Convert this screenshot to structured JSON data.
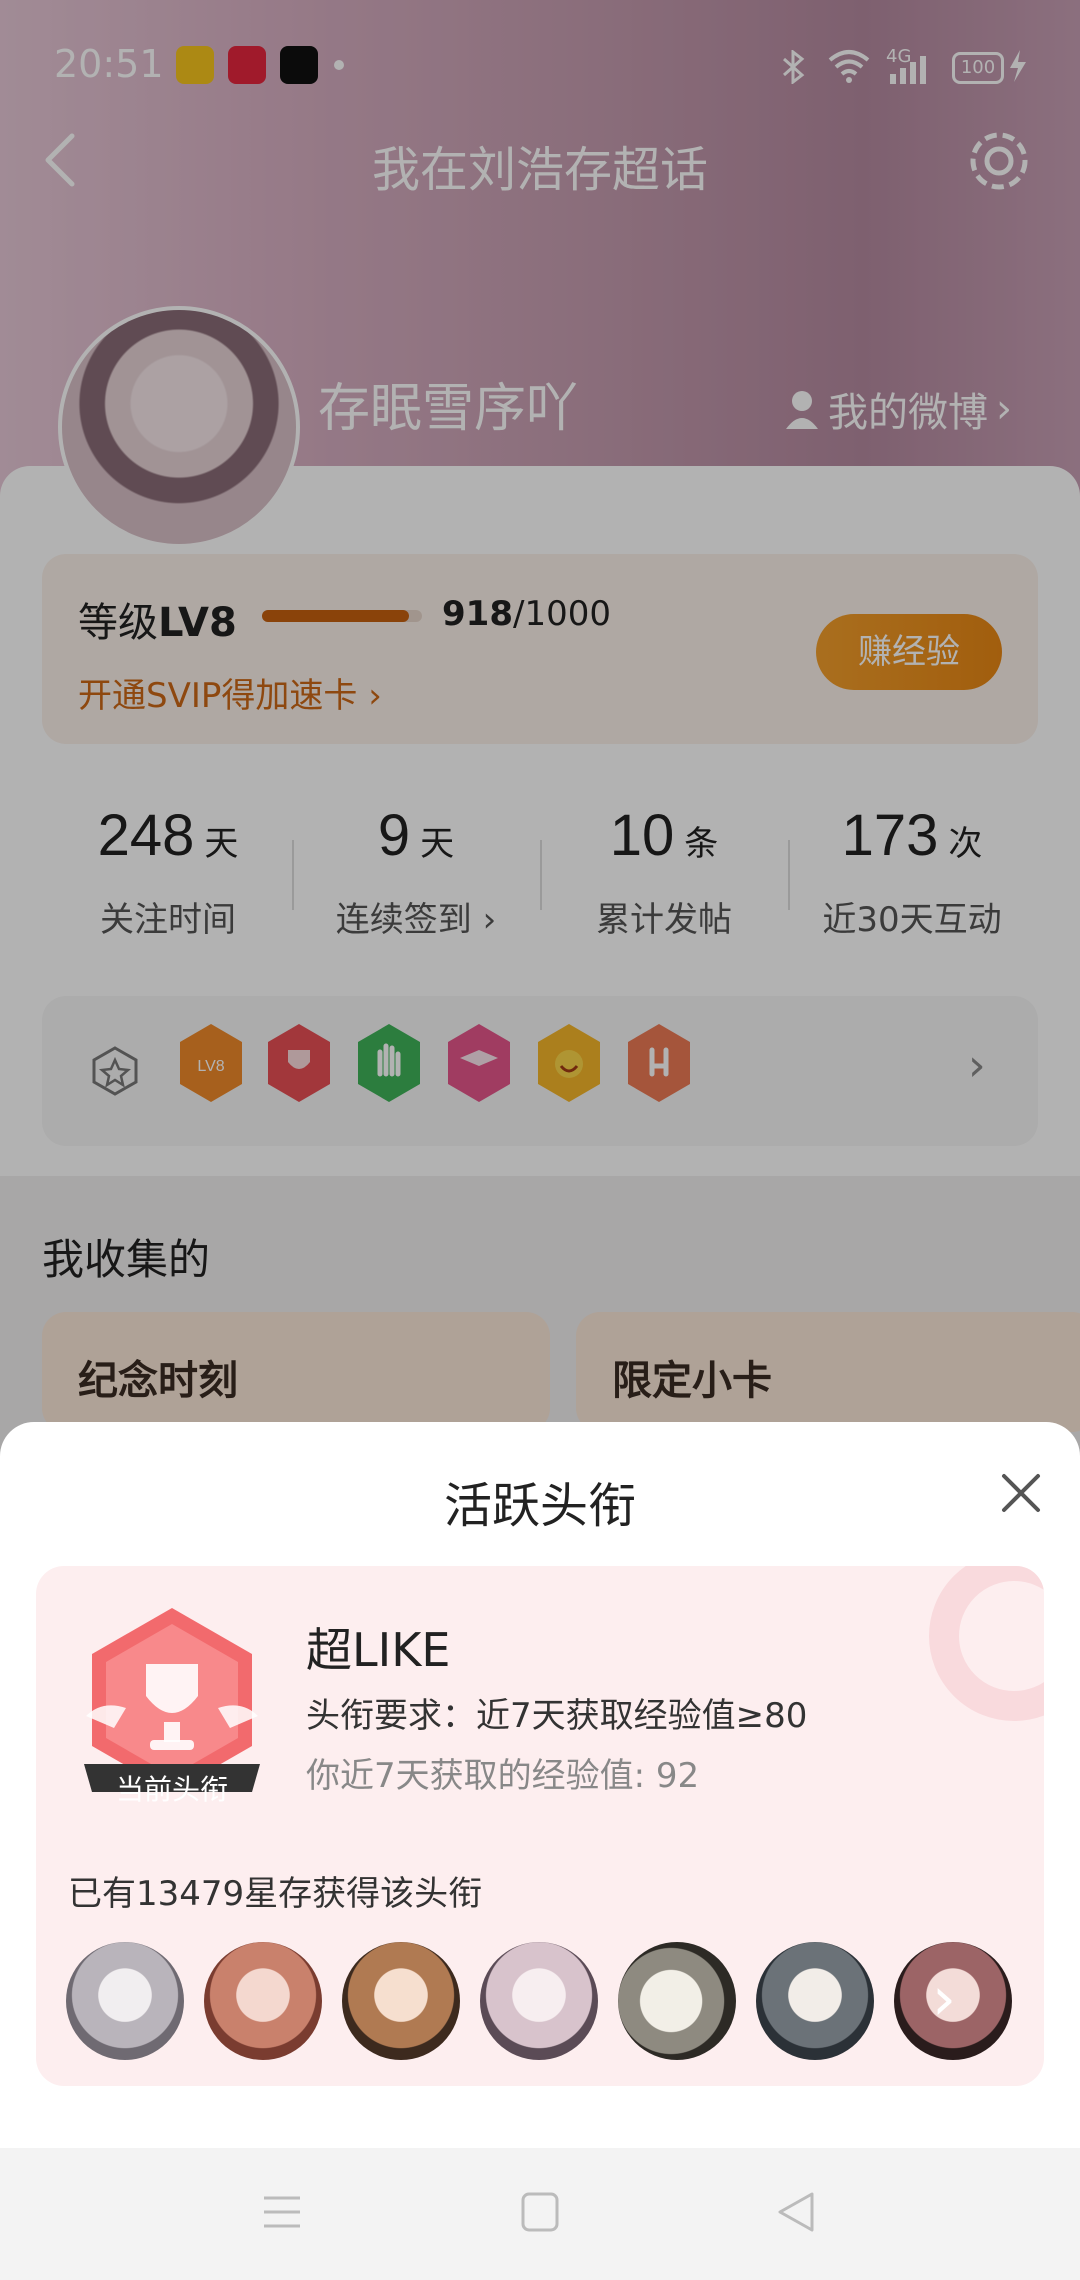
{
  "status_bar": {
    "time": "20:51",
    "network": "4G",
    "battery": "100",
    "icons": [
      "weibo-icon",
      "xiaohongshu-icon",
      "tiktok-icon",
      "bluetooth-icon",
      "wifi-icon",
      "signal-icon",
      "battery-icon",
      "charging-icon"
    ]
  },
  "header": {
    "title": "我在刘浩存超话",
    "back_icon": "back-icon",
    "settings_icon": "settings-icon"
  },
  "profile": {
    "username": "存眠雪序吖",
    "my_weibo_label": "我的微博"
  },
  "level": {
    "label_prefix": "等级",
    "level": "LV8",
    "current": "918",
    "total": "/1000",
    "progress": 0.918,
    "svip_link": "开通SVIP得加速卡",
    "earn_button": "赚经验"
  },
  "stats": [
    {
      "value": "248",
      "unit": "天",
      "label": "关注时间"
    },
    {
      "value": "9",
      "unit": "天",
      "label": "连续签到"
    },
    {
      "value": "10",
      "unit": "条",
      "label": "累计发帖"
    },
    {
      "value": "173",
      "unit": "次",
      "label": "近30天互动"
    }
  ],
  "badges": [
    "lv8-badge",
    "trophy-badge",
    "hand-badge",
    "graduation-badge",
    "laughing-badge",
    "rock-hand-badge"
  ],
  "collection": {
    "title": "我收集的",
    "cards": [
      {
        "title": "纪念时刻"
      },
      {
        "title": "限定小卡"
      }
    ]
  },
  "sheet": {
    "title": "活跃头衔",
    "badge_label": "当前头衔",
    "title_name": "超LIKE",
    "requirement": "头衔要求：近7天获取经验值≥80",
    "mine": "你近7天获取的经验值: 92",
    "holders_text": "已有13479星存获得该头衔"
  },
  "colors": {
    "accent_orange": "#e88714",
    "level_text": "#cc6716",
    "sheet_bg": "#fdeeef",
    "badge_red": "#e94f55"
  }
}
